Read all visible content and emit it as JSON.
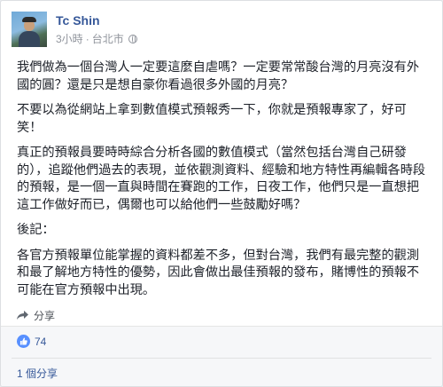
{
  "post": {
    "author": "Tc Shin",
    "time": "3小時",
    "separator": "·",
    "location": "台北市",
    "privacy_icon": "globe-icon",
    "paragraphs": [
      "我們做為一個台灣人一定要這麼自虐嗎？一定要常常酸台灣的月亮沒有外國的圓？還是只是想自豪你看過很多外國的月亮？",
      "不要以為從網站上拿到數值模式預報秀一下，你就是預報專家了，好可笑！",
      "真正的預報員要時時綜合分析各國的數值模式（當然包括台灣自己研發的），追蹤他們過去的表現，並依觀測資料、經驗和地方特性再編輯各時段的預報，是一個一直與時間在賽跑的工作，日夜工作，他們只是一直想把這工作做好而已，偶爾也可以給他們一些鼓勵好嗎？",
      "後記：",
      "各官方預報單位能掌握的資料都差不多，但對台灣，我們有最完整的觀測和最了解地方特性的優勢，因此會做出最佳預報的發布，賭博性的預報不可能在官方預報中出現。"
    ]
  },
  "actions": {
    "share_label": "分享",
    "share_icon": "share-arrow-icon"
  },
  "stats": {
    "likes_count": "74",
    "like_icon": "thumbs-up-icon",
    "shares_label": "1 個分享"
  },
  "colors": {
    "link": "#365899",
    "meta": "#90949c",
    "like_badge": "#5890ff",
    "footer_bg": "#f6f7f9"
  }
}
